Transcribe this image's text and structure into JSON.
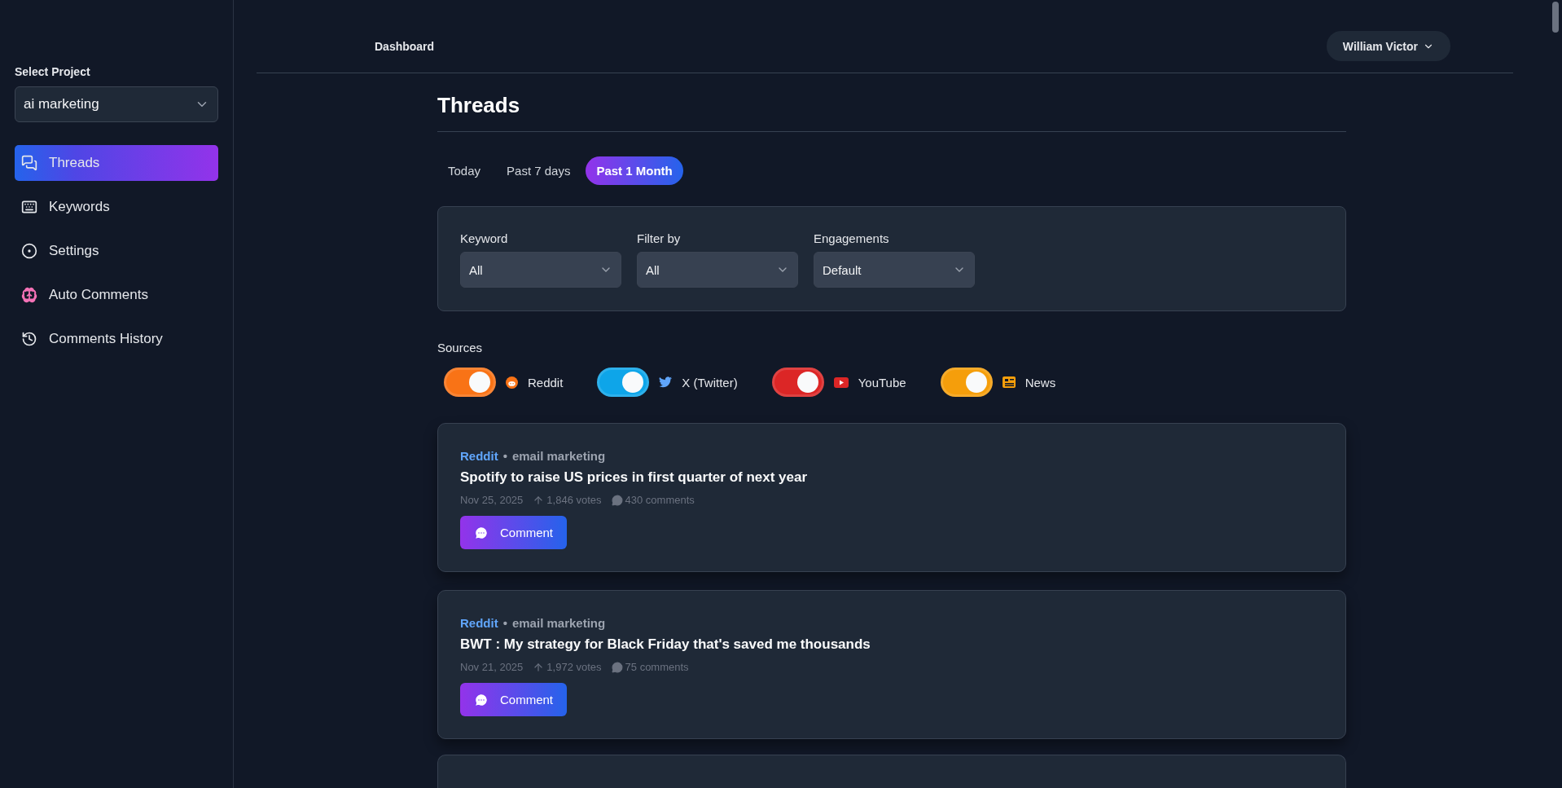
{
  "sidebar": {
    "project_label": "Select Project",
    "project": "ai marketing",
    "items": [
      {
        "label": "Threads",
        "kind": "threads",
        "selected": true
      },
      {
        "label": "Keywords",
        "kind": "keyboard",
        "selected": false
      },
      {
        "label": "Settings",
        "kind": "settings",
        "selected": false
      },
      {
        "label": "Auto Comments",
        "kind": "brain",
        "selected": false
      },
      {
        "label": "Comments History",
        "kind": "history",
        "selected": false
      }
    ]
  },
  "header": {
    "breadcrumb": "Dashboard",
    "user": "William Victor"
  },
  "page_title": "Threads",
  "tabs": [
    {
      "label": "Today",
      "selected": false
    },
    {
      "label": "Past 7 days",
      "selected": false
    },
    {
      "label": "Past 1 Month",
      "selected": true
    }
  ],
  "filters": [
    {
      "label": "Keyword",
      "value": "All"
    },
    {
      "label": "Filter by",
      "value": "All"
    },
    {
      "label": "Engagements",
      "value": "Default"
    }
  ],
  "sources_label": "Sources",
  "sources": [
    {
      "name": "Reddit",
      "kind": "reddit",
      "on": true,
      "color": "#f97316"
    },
    {
      "name": "X (Twitter)",
      "kind": "twitter",
      "on": true,
      "color": "#0ea5e9"
    },
    {
      "name": "YouTube",
      "kind": "youtube",
      "on": true,
      "color": "#dc2626"
    },
    {
      "name": "News",
      "kind": "news",
      "on": true,
      "color": "#f59e0b"
    }
  ],
  "threads": [
    {
      "source": "Reddit",
      "separator": "•",
      "topic": "email marketing",
      "title": "Spotify to raise US prices in first quarter of next year",
      "date": "Nov 25, 2025",
      "votes": "1,846 votes",
      "comments": "430 comments",
      "action": "Comment"
    },
    {
      "source": "Reddit",
      "separator": "•",
      "topic": "email marketing",
      "title": "BWT : My strategy for Black Friday that's saved me thousands",
      "date": "Nov 21, 2025",
      "votes": "1,972 votes",
      "comments": "75 comments",
      "action": "Comment"
    }
  ],
  "more_threads_below": true
}
